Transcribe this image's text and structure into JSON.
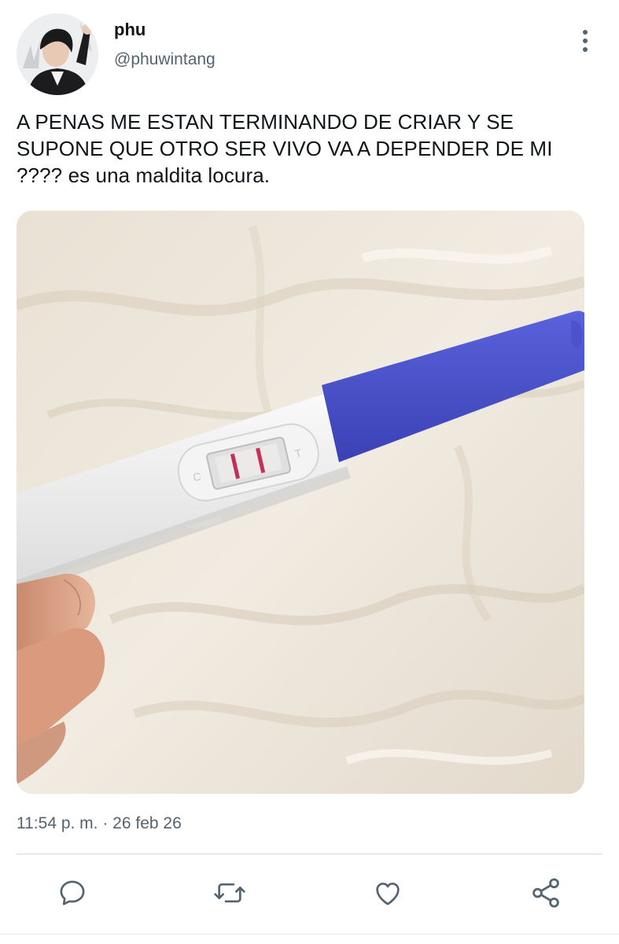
{
  "author": {
    "display_name": "phu",
    "handle": "@phuwintang"
  },
  "tweet": {
    "text": "A PENAS ME ESTAN TERMINANDO DE CRIAR Y SE SUPONE QUE OTRO SER VIVO VA A DEPENDER DE MI ???? es una maldita locura.",
    "timestamp": "11:54 p. m. · 26 feb 26"
  },
  "icons": {
    "more": "more-vertical-icon",
    "reply": "reply-icon",
    "retweet": "retweet-icon",
    "like": "heart-icon",
    "share": "share-icon"
  },
  "colors": {
    "text_primary": "#0f1419",
    "text_secondary": "#536471",
    "divider": "#cfd9de",
    "test_handle_blue": "#4a52c9"
  }
}
